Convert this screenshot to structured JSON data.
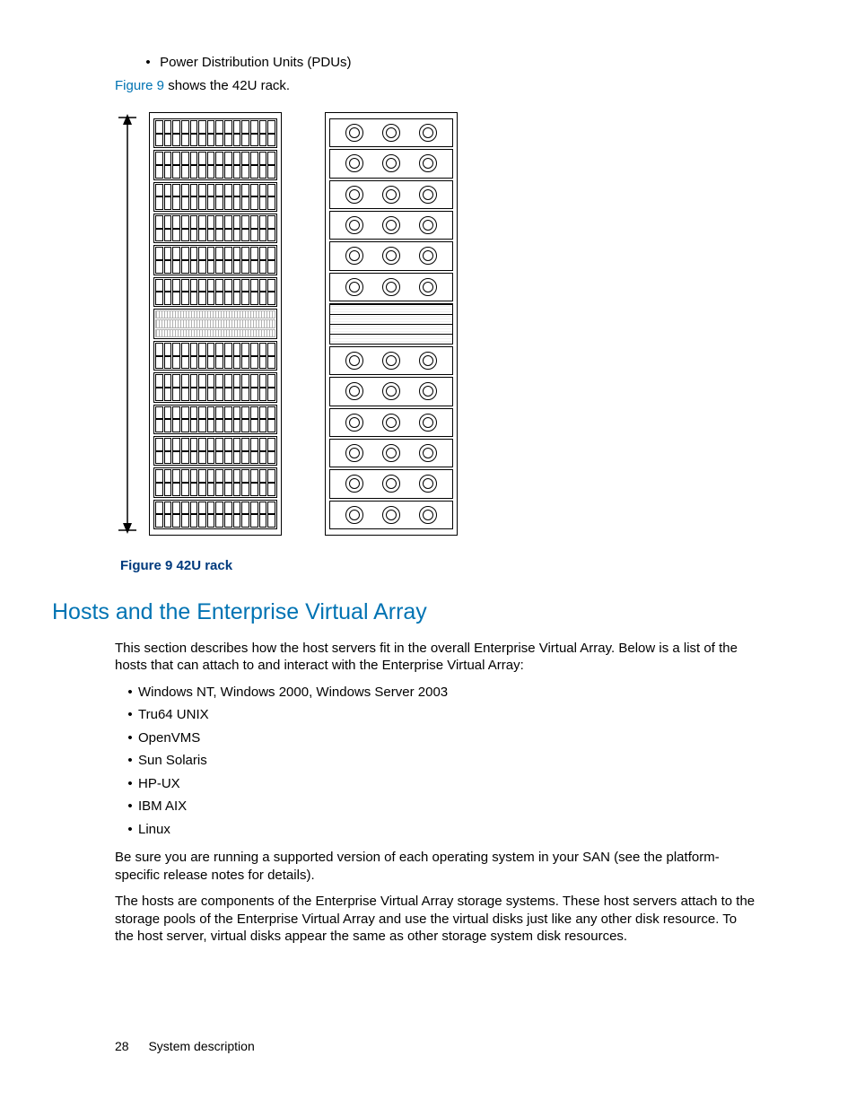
{
  "top_bullet": "Power Distribution Units (PDUs)",
  "caption_link": "Figure 9",
  "caption_rest": " shows the 42U rack.",
  "figure_caption": "Figure 9 42U rack",
  "section_heading": "Hosts and the Enterprise Virtual Array",
  "intro_para": "This section describes how the host servers fit in the overall Enterprise Virtual Array. Below is a list of the hosts that can attach to and interact with the Enterprise Virtual Array:",
  "os_list": [
    "Windows NT, Windows 2000, Windows Server 2003",
    "Tru64 UNIX",
    "OpenVMS",
    "Sun Solaris",
    "HP-UX",
    "IBM AIX",
    "Linux"
  ],
  "support_para": "Be sure you are running a supported version of each operating system in your SAN (see the platform-specific release notes for details).",
  "hosts_para": "The hosts are components of the Enterprise Virtual Array storage systems. These host servers attach to the storage pools of the Enterprise Virtual Array and use the virtual disks just like any other disk resource. To the host server, virtual disks appear the same as other storage system disk resources.",
  "footer": {
    "page_number": "28",
    "chapter": "System description"
  }
}
